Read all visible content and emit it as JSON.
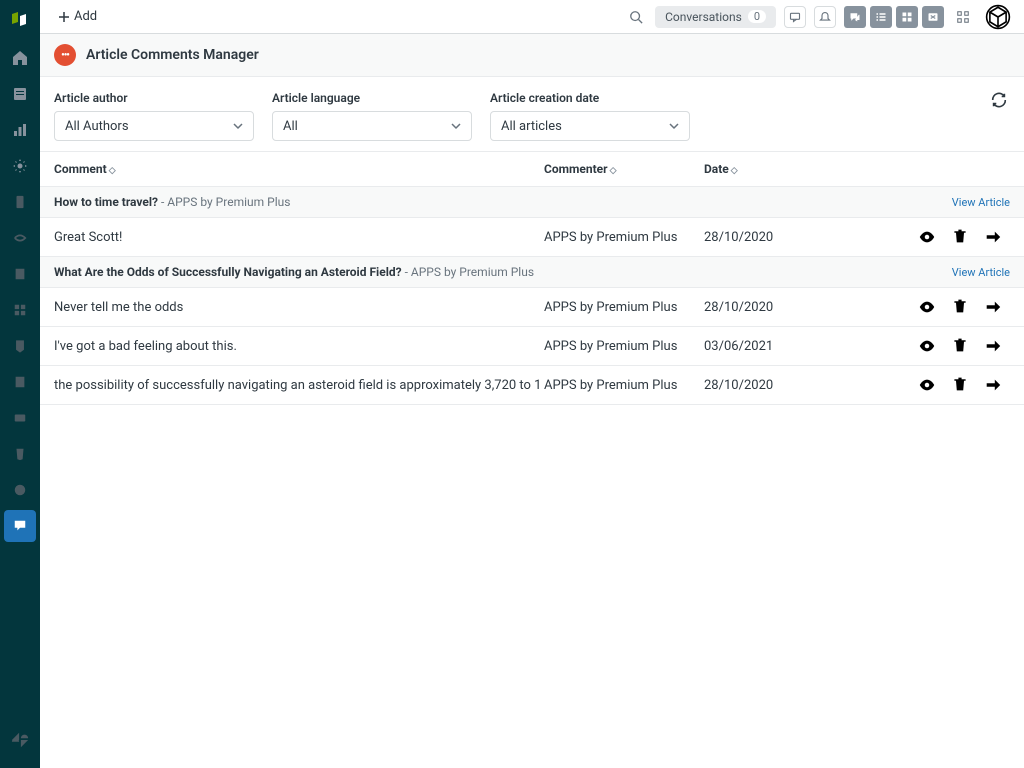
{
  "topbar": {
    "add_label": "Add",
    "conversations_label": "Conversations",
    "conversations_count": "0"
  },
  "page": {
    "title": "Article Comments Manager"
  },
  "filters": {
    "author": {
      "label": "Article author",
      "value": "All Authors"
    },
    "language": {
      "label": "Article language",
      "value": "All"
    },
    "created": {
      "label": "Article creation date",
      "value": "All articles"
    }
  },
  "table": {
    "columns": {
      "comment": "Comment",
      "commenter": "Commenter",
      "date": "Date"
    },
    "view_article_label": "View Article",
    "groups": [
      {
        "title": "How to time travel?",
        "author": "APPS by Premium Plus",
        "rows": [
          {
            "comment": "Great Scott!",
            "commenter": "APPS by Premium Plus",
            "date": "28/10/2020"
          }
        ]
      },
      {
        "title": "What Are the Odds of Successfully Navigating an Asteroid Field?",
        "author": "APPS by Premium Plus",
        "rows": [
          {
            "comment": "Never tell me the odds",
            "commenter": "APPS by Premium Plus",
            "date": "28/10/2020"
          },
          {
            "comment": "I've got a bad feeling about this.",
            "commenter": "APPS by Premium Plus",
            "date": "03/06/2021"
          },
          {
            "comment": "the possibility of successfully navigating an asteroid field is approximately 3,720 to 1",
            "commenter": "APPS by Premium Plus",
            "date": "28/10/2020"
          }
        ]
      }
    ]
  }
}
